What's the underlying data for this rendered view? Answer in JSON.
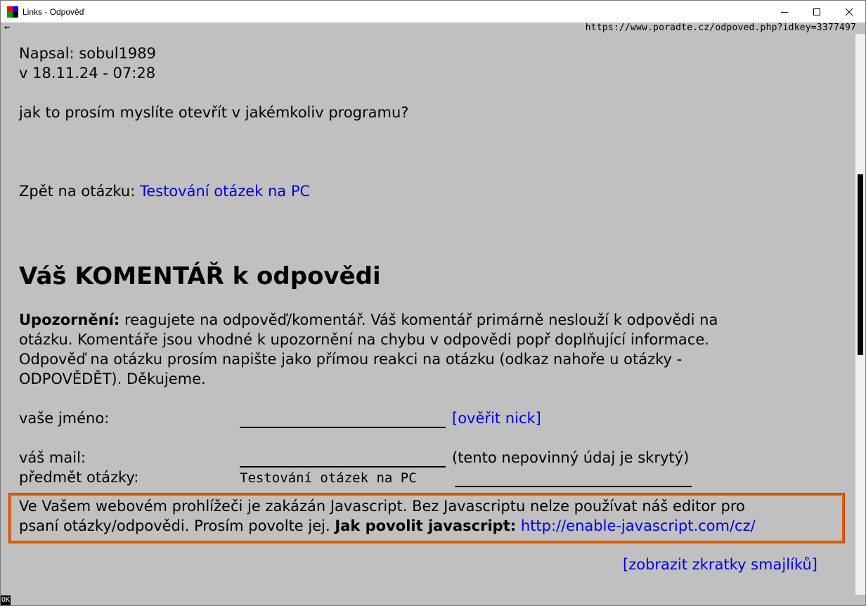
{
  "window": {
    "title": "Links - Odpověď",
    "icon_colors": [
      "#ff0000",
      "#0000ff",
      "#00a000",
      "#000000"
    ]
  },
  "urlbar": {
    "back_glyph": "←",
    "url": "https://www.poradte.cz/odpoved.php?idkey=3377497"
  },
  "post": {
    "author_line": "Napsal: sobul1989",
    "date_line": "v 18.11.24 - 07:28",
    "body": "jak to prosím myslíte otevřít v jakémkoliv programu?"
  },
  "back": {
    "label": "Zpět na otázku: ",
    "link_text": "Testování otázek na PC"
  },
  "comment": {
    "heading": "Váš KOMENTÁŘ k odpovědi",
    "notice_bold": "Upozornění:",
    "notice_line1": " reagujete na odpověď/komentář. Váš komentář primárně neslouží k odpovědi na",
    "notice_line2": "otázku. Komentáře jsou vhodné k upozornění na chybu v odpovědi popř doplňující informace.",
    "notice_line3": "Odpověď na otázku prosím napište jako přímou reakci na otázku (odkaz nahoře u otázky -",
    "notice_line4": "ODPOVĚDĚT). Děkujeme."
  },
  "form": {
    "name_label": "vaše jméno:",
    "name_value": "",
    "verify_nick": "[ověřit nick]",
    "mail_label": "váš mail:",
    "mail_value": "",
    "mail_note": "(tento nepovinný údaj je skrytý)",
    "subject_label": "předmět otázky:",
    "subject_value": "Testování otázek na PC"
  },
  "js_warning": {
    "line1": "Ve Vašem webovém prohlížeči je zakázán Javascript. Bez Javascriptu nelze používat náš editor pro",
    "line2_text": "psaní otázky/odpovědi. Prosím povolte jej. ",
    "line2_bold": "Jak povolit javascript:",
    "line2_link": "http://enable-javascript.com/cz/"
  },
  "smileys_link": "[zobrazit zkratky smajlíků]",
  "status": {
    "text": "OK"
  }
}
